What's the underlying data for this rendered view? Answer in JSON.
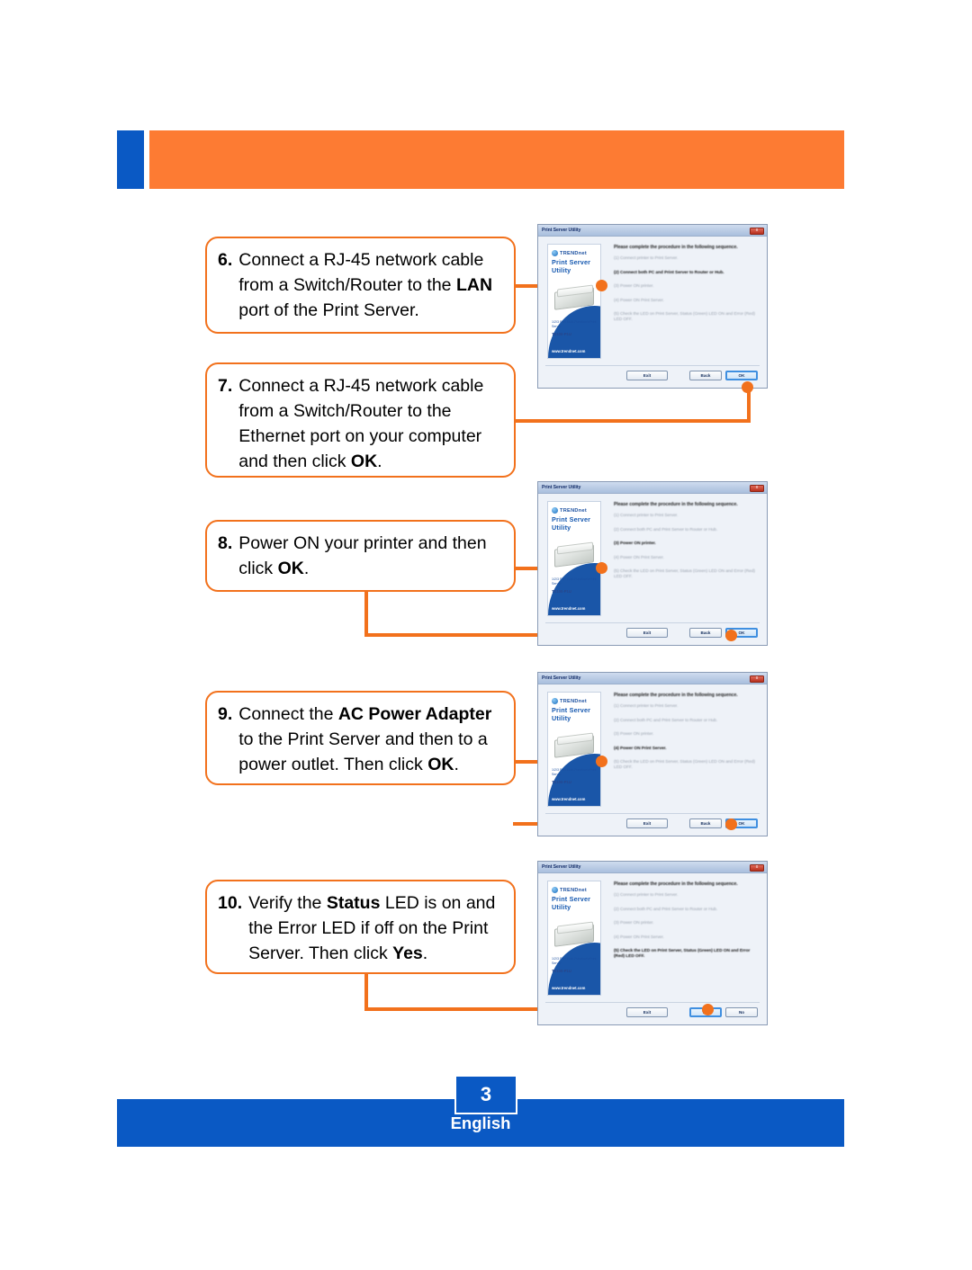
{
  "header": {
    "accent_blue": "#0a59c4",
    "accent_orange": "#fd7b33"
  },
  "steps": [
    {
      "number": "6.",
      "text_html": "Connect a RJ-45 network cable from a Switch/Router to the <b>LAN</b> port of the Print Server.",
      "plain": "Connect a RJ-45 network cable from a Switch/Router to the LAN port of the Print Server."
    },
    {
      "number": "7.",
      "text_html": "Connect a RJ-45 network cable from a Switch/Router to the Ethernet port on your computer and then click <b>OK</b>.",
      "plain": "Connect a RJ-45 network cable from a Switch/Router to the Ethernet port on your computer and then click OK."
    },
    {
      "number": "8.",
      "text_html": "Power ON your printer and then click <b>OK</b>.",
      "plain": "Power ON your printer and then click OK."
    },
    {
      "number": "9.",
      "text_html": "Connect the <b>AC Power Adapter</b> to the Print Server and then to a power outlet.  Then click <b>OK</b>.",
      "plain": "Connect the AC Power Adapter to the Print Server and then to a power outlet. Then click OK."
    },
    {
      "number": "10.",
      "text_html": "Verify the <b>Status</b> LED is on and the Error LED if off on the Print Server.  Then click <b>Yes</b>.",
      "plain": "Verify the Status LED is on and the Error LED if off on the Print Server. Then click Yes."
    }
  ],
  "dialog": {
    "title": "Print Server Utility",
    "close_label": "x",
    "brand": {
      "logo_text": "TRENDnet",
      "product_title": "Print Server Utility",
      "specs": "1/2/3 Port Multi-Function\\nPrint Server",
      "model": "TE100-P1U",
      "url": "www.trendnet.com"
    },
    "heading": "Please complete the procedure in the following sequence.",
    "items": [
      "(1) Connect printer to Print Server.",
      "(2) Connect both PC and Print Server to Router or Hub.",
      "(3) Power ON printer.",
      "(4) Power ON Print Server.",
      "(5) Check the LED on Print Server, Status (Green) LED ON and Error (Red) LED OFF."
    ],
    "buttons": {
      "exit": "Exit",
      "back": "Back",
      "ok": "OK",
      "yes": "Yes",
      "no": "No"
    }
  },
  "dialog_instances": [
    {
      "active_index": 1,
      "focus_button": "ok"
    },
    {
      "active_index": 2,
      "focus_button": "ok"
    },
    {
      "active_index": 3,
      "focus_button": "ok"
    },
    {
      "active_index": 4,
      "focus_button": "yes"
    }
  ],
  "footer": {
    "page_number": "3",
    "language": "English"
  }
}
